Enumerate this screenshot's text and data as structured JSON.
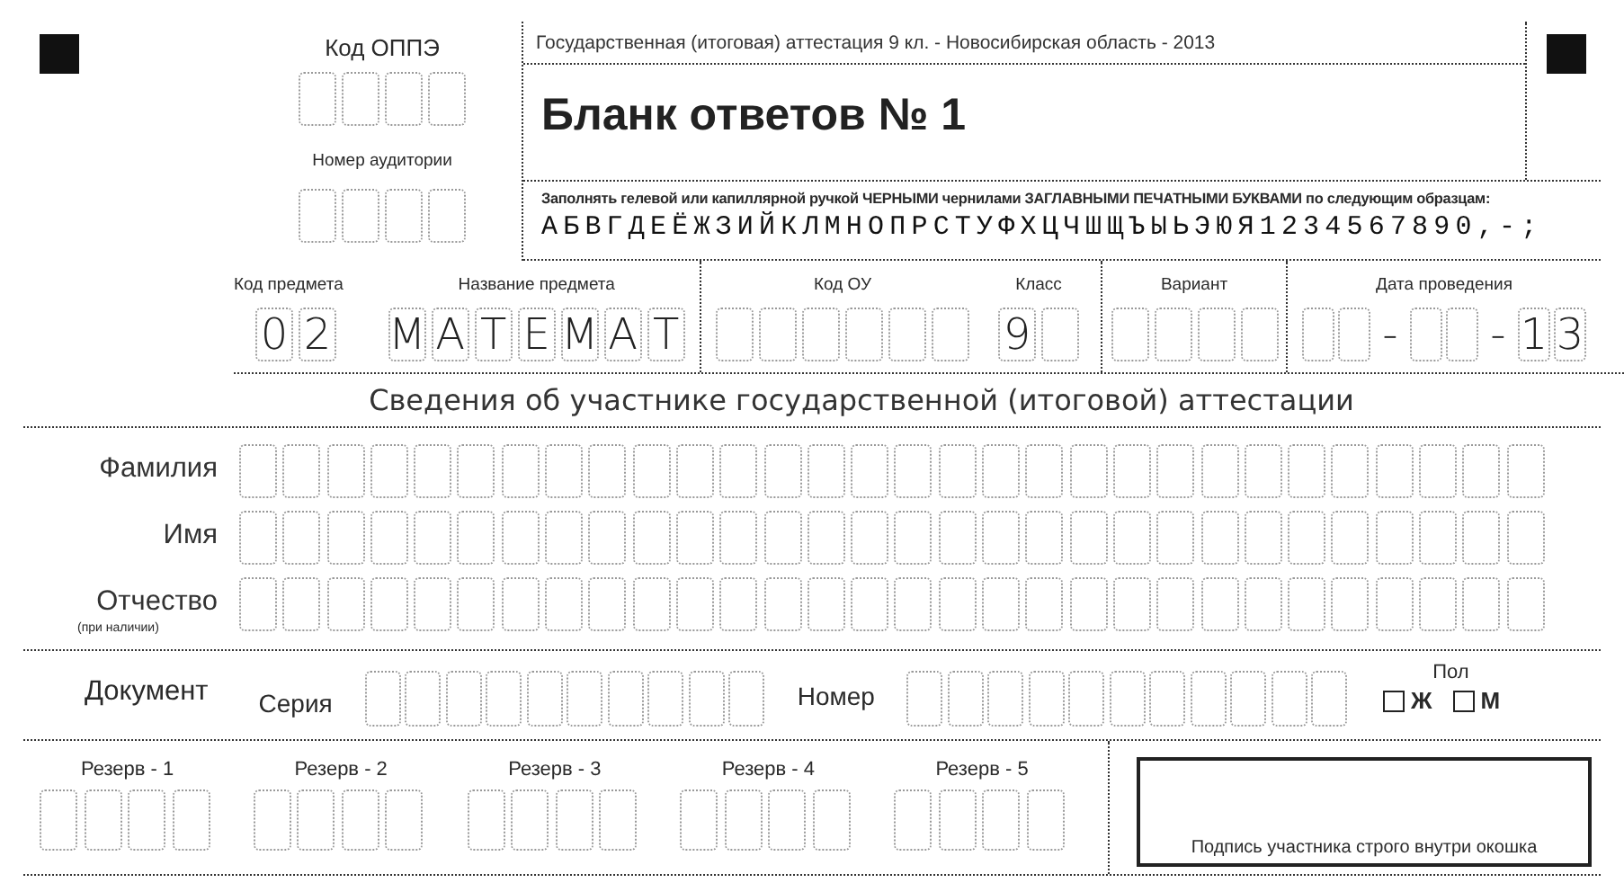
{
  "header": {
    "line": "Государственная (итоговая) аттестация 9 кл. - Новосибирская область - 2013",
    "title": "Бланк ответов № 1",
    "instruction": "Заполнять гелевой или капиллярной ручкой ЧЕРНЫМИ чернилами ЗАГЛАВНЫМИ ПЕЧАТНЫМИ БУКВАМИ по следующим образцам:",
    "sample": "АБВГДЕЁЖЗИЙКЛМНОПРСТУФХЦЧШЩЪЫЬЭЮЯ1234567890,-;"
  },
  "oppe": {
    "label": "Код ОППЭ",
    "cells": [
      {},
      {},
      {},
      {}
    ]
  },
  "room": {
    "label": "Номер аудитории",
    "cells": [
      {},
      {},
      {},
      {}
    ]
  },
  "subject_code": {
    "label": "Код предмета",
    "cells": [
      {
        "char": "0"
      },
      {
        "char": "2"
      }
    ]
  },
  "subject_name": {
    "label": "Название предмета",
    "cells": [
      {
        "char": "М"
      },
      {
        "char": "А"
      },
      {
        "char": "Т"
      },
      {
        "char": "Е"
      },
      {
        "char": "М"
      },
      {
        "char": "А"
      },
      {
        "char": "Т"
      }
    ]
  },
  "school_code": {
    "label": "Код ОУ",
    "cells": [
      {},
      {},
      {},
      {},
      {},
      {}
    ]
  },
  "grade": {
    "label": "Класс",
    "cells": [
      {
        "char": "9"
      },
      {}
    ]
  },
  "variant": {
    "label": "Вариант",
    "cells": [
      {},
      {},
      {},
      {}
    ]
  },
  "date": {
    "label": "Дата проведения",
    "cells": [
      {
        "kind": "box"
      },
      {
        "kind": "box"
      },
      {
        "kind": "separator",
        "char": "-"
      },
      {
        "kind": "box"
      },
      {
        "kind": "box"
      },
      {
        "kind": "separator",
        "char": "-"
      },
      {
        "kind": "box",
        "char": "1"
      },
      {
        "kind": "box",
        "char": "3"
      }
    ]
  },
  "section_title": "Сведения об участнике государственной (итоговой) аттестации",
  "person": [
    {
      "label": "Фамилия",
      "cells": [
        {},
        {},
        {},
        {},
        {},
        {},
        {},
        {},
        {},
        {},
        {},
        {},
        {},
        {},
        {},
        {},
        {},
        {},
        {},
        {},
        {},
        {},
        {},
        {},
        {},
        {},
        {},
        {},
        {},
        {}
      ]
    },
    {
      "label": "Имя",
      "cells": [
        {},
        {},
        {},
        {},
        {},
        {},
        {},
        {},
        {},
        {},
        {},
        {},
        {},
        {},
        {},
        {},
        {},
        {},
        {},
        {},
        {},
        {},
        {},
        {},
        {},
        {},
        {},
        {},
        {},
        {}
      ]
    },
    {
      "label": "Отчество",
      "note": "(при наличии)",
      "cells": [
        {},
        {},
        {},
        {},
        {},
        {},
        {},
        {},
        {},
        {},
        {},
        {},
        {},
        {},
        {},
        {},
        {},
        {},
        {},
        {},
        {},
        {},
        {},
        {},
        {},
        {},
        {},
        {},
        {},
        {}
      ]
    }
  ],
  "document": {
    "label": "Документ",
    "series": {
      "label": "Серия",
      "cells": [
        {},
        {},
        {},
        {},
        {},
        {},
        {},
        {},
        {},
        {}
      ]
    },
    "number": {
      "label": "Номер",
      "cells": [
        {},
        {},
        {},
        {},
        {},
        {},
        {},
        {},
        {},
        {},
        {}
      ]
    }
  },
  "sex": {
    "label": "Пол",
    "options": [
      {
        "label": "Ж",
        "checked": false
      },
      {
        "label": "М",
        "checked": false
      }
    ]
  },
  "reserves": [
    {
      "label": "Резерв - 1",
      "cells": [
        {},
        {},
        {},
        {}
      ]
    },
    {
      "label": "Резерв - 2",
      "cells": [
        {},
        {},
        {},
        {}
      ]
    },
    {
      "label": "Резерв - 3",
      "cells": [
        {},
        {},
        {},
        {}
      ]
    },
    {
      "label": "Резерв - 4",
      "cells": [
        {},
        {},
        {},
        {}
      ]
    },
    {
      "label": "Резерв - 5",
      "cells": [
        {},
        {},
        {},
        {}
      ]
    }
  ],
  "signature": {
    "caption": "Подпись участника строго внутри окошка"
  }
}
